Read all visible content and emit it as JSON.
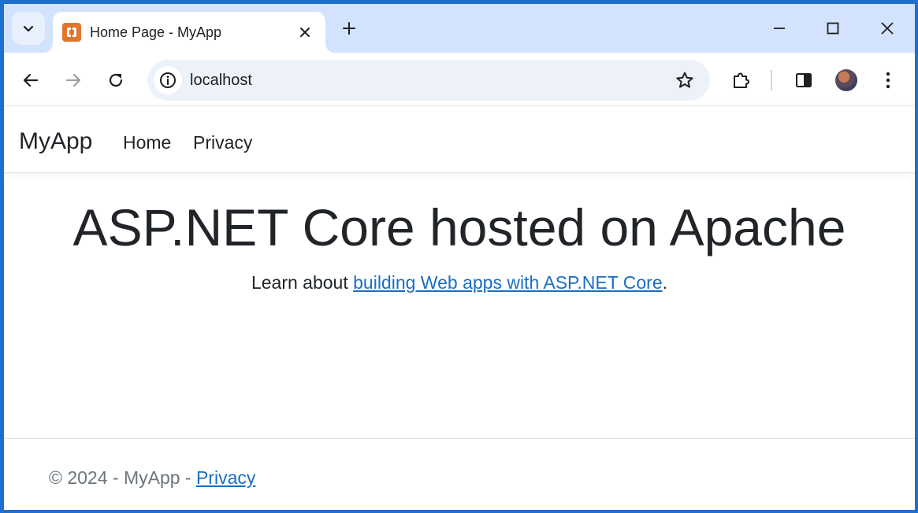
{
  "browser": {
    "tab": {
      "title": "Home Page - MyApp",
      "favicon": "xampp-icon",
      "close_icon": "close-icon"
    },
    "new_tab_icon": "plus-icon",
    "window_controls": [
      "minimize-icon",
      "maximize-icon",
      "close-icon"
    ],
    "toolbar": {
      "back_icon": "back-arrow-icon",
      "forward_icon": "forward-arrow-icon",
      "reload_icon": "reload-icon",
      "site_info_icon": "info-icon",
      "url": "localhost",
      "bookmark_icon": "star-icon",
      "extensions_icon": "puzzle-icon",
      "side_panel_icon": "side-panel-icon",
      "menu_icon": "kebab-menu-icon"
    }
  },
  "page": {
    "navbar": {
      "brand": "MyApp",
      "links": [
        "Home",
        "Privacy"
      ]
    },
    "hero": {
      "heading": "ASP.NET Core hosted on Apache",
      "learn_prefix": "Learn about ",
      "learn_link": "building Web apps with ASP.NET Core",
      "learn_suffix": "."
    },
    "footer": {
      "text": "© 2024 - MyApp - ",
      "link": "Privacy"
    }
  },
  "colors": {
    "tabstrip_bg": "#d3e3fd",
    "omnibox_bg": "#edf2fa",
    "link": "#1b6ec2",
    "favicon": "#e0762e"
  }
}
